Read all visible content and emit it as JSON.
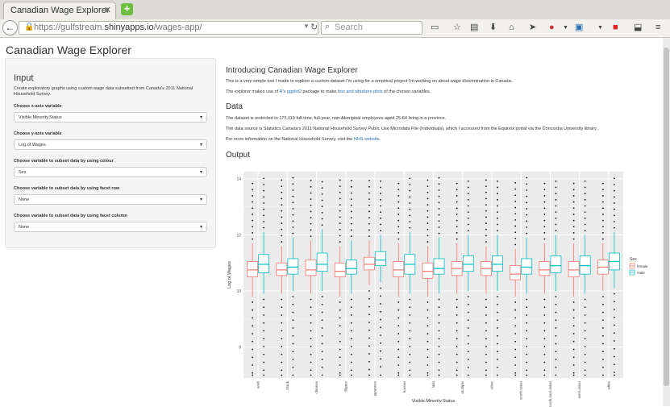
{
  "browser": {
    "tab_title": "Canadian Wage Explorer",
    "url_prefix": "https://gulfstream.",
    "url_domain": "shinyapps.io",
    "url_path": "/wages-app/",
    "search_placeholder": "Search"
  },
  "app": {
    "title": "Canadian Wage Explorer"
  },
  "sidebar": {
    "heading": "Input",
    "description": "Create exploratory graphs using custom wage data subsetted from Canada's 2011 National Household Survey.",
    "controls": [
      {
        "label": "Choose x-axis variable",
        "value": "Visible.Minority.Status"
      },
      {
        "label": "Choose y-axis variable",
        "value": "Log.of.Wages"
      },
      {
        "label": "Choose variable to subset data by using colour",
        "value": "Sex"
      },
      {
        "label": "Choose variable to subset data by using facet row",
        "value": "None"
      },
      {
        "label": "Choose variable to subset data by using facet column",
        "value": "None"
      }
    ]
  },
  "main": {
    "intro_heading": "Introducing Canadian Wage Explorer",
    "intro_p1": "This is a very simple tool I made to explore a custom dataset I'm using for a empirical project I'm working on about wage discrimination in Canada.",
    "intro_p2_a": "The explorer makes use of ",
    "intro_p2_link1": "R's ggplot2",
    "intro_p2_b": " package to make ",
    "intro_p2_link2": "box and whiskers plots",
    "intro_p2_c": " of the chosen variables.",
    "data_heading": "Data",
    "data_p1": "The dataset is restricted to 175,119 full-time, full-year, non-Aboriginal employees aged 25-64 living in a province.",
    "data_p2": "The data source is Statistics Canada's 2011 National Household Survey Public Use Microdata File (Individuals), which I accessed from the Equinox portal via the Concordia University library.",
    "data_p3_a": "For more information on the National Household Survey, visit the ",
    "data_p3_link": "NHS website",
    "data_p3_b": ".",
    "output_heading": "Output"
  },
  "chart_data": {
    "type": "box",
    "xlabel": "Visible.Minority.Status",
    "ylabel": "Log.of.Wages",
    "yticks": [
      8,
      10,
      12,
      14
    ],
    "ylim": [
      6.9,
      14.25
    ],
    "categories": [
      "arab",
      "black",
      "chinese",
      "filipino",
      "japanese",
      "korean",
      "latin",
      "multiple",
      "other",
      "south.asian",
      "south.east.asian",
      "west.asian",
      "white"
    ],
    "legend_title": "Sex",
    "series": [
      {
        "name": "female",
        "color": "#F8766D",
        "boxes": [
          [
            9.8,
            10.5,
            10.75,
            11.05,
            11.7
          ],
          [
            9.9,
            10.55,
            10.75,
            11.0,
            11.6
          ],
          [
            9.9,
            10.55,
            10.75,
            11.1,
            11.8
          ],
          [
            9.8,
            10.5,
            10.7,
            11.0,
            11.6
          ],
          [
            10.2,
            10.75,
            10.95,
            11.2,
            11.8
          ],
          [
            9.8,
            10.5,
            10.75,
            11.05,
            11.7
          ],
          [
            9.8,
            10.45,
            10.7,
            11.0,
            11.6
          ],
          [
            9.9,
            10.55,
            10.8,
            11.05,
            11.7
          ],
          [
            9.9,
            10.55,
            10.8,
            11.05,
            11.6
          ],
          [
            9.8,
            10.4,
            10.6,
            10.9,
            11.5
          ],
          [
            9.9,
            10.55,
            10.75,
            11.05,
            11.7
          ],
          [
            9.8,
            10.5,
            10.75,
            11.05,
            11.7
          ],
          [
            10.0,
            10.6,
            10.85,
            11.1,
            11.7
          ]
        ]
      },
      {
        "name": "male",
        "color": "#00BFC4",
        "boxes": [
          [
            9.9,
            10.65,
            10.95,
            11.3,
            12.1
          ],
          [
            10.0,
            10.6,
            10.85,
            11.15,
            11.9
          ],
          [
            10.0,
            10.7,
            10.95,
            11.35,
            12.2
          ],
          [
            9.9,
            10.6,
            10.8,
            11.1,
            11.8
          ],
          [
            10.3,
            10.9,
            11.1,
            11.4,
            12.0
          ],
          [
            9.9,
            10.6,
            10.95,
            11.3,
            12.1
          ],
          [
            9.9,
            10.6,
            10.8,
            11.15,
            11.9
          ],
          [
            10.0,
            10.7,
            10.95,
            11.25,
            12.0
          ],
          [
            10.0,
            10.7,
            10.95,
            11.25,
            12.0
          ],
          [
            9.9,
            10.6,
            10.85,
            11.15,
            11.9
          ],
          [
            10.0,
            10.65,
            10.9,
            11.25,
            12.0
          ],
          [
            9.9,
            10.6,
            10.9,
            11.25,
            12.0
          ],
          [
            10.1,
            10.75,
            11.05,
            11.35,
            12.1
          ]
        ]
      }
    ]
  }
}
